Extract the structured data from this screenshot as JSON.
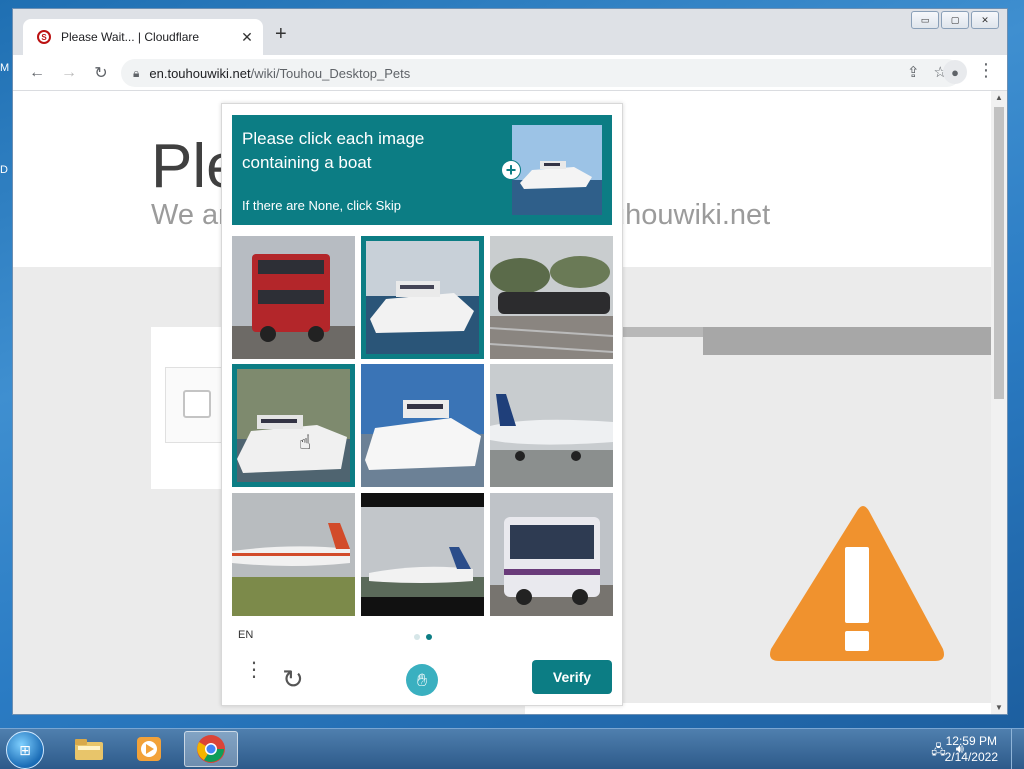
{
  "desktop": {
    "left_fragments": [
      "M",
      "D"
    ]
  },
  "window": {
    "tab": {
      "title": "Please Wait... | Cloudflare",
      "close": "✕"
    },
    "new_tab": "+",
    "controls": {
      "minimize": "▭",
      "maximize": "▢",
      "close": "✕"
    }
  },
  "toolbar": {
    "back": "←",
    "forward": "→",
    "reload": "↻",
    "url_host": "en.touhouwiki.net",
    "url_path": "/wiki/Touhou_Desktop_Pets",
    "share": "⇪",
    "bookmark": "☆",
    "profile": "●",
    "menu": "⋮"
  },
  "page": {
    "title_fragment": "Ple",
    "subtitle_fragment": "We ar",
    "site_fragment": "uhouwiki.net",
    "warning_exclamation": "!"
  },
  "captcha": {
    "prompt_line": "Please click each image containing a boat",
    "prompt_sub": "If there are None, click Skip",
    "example_image": "boat",
    "add": "+",
    "grid": [
      {
        "image": "bus",
        "selected": false
      },
      {
        "image": "boat",
        "selected": true
      },
      {
        "image": "train",
        "selected": false
      },
      {
        "image": "boat",
        "selected": true
      },
      {
        "image": "boat",
        "selected": false
      },
      {
        "image": "airplane",
        "selected": false
      },
      {
        "image": "airplane",
        "selected": false
      },
      {
        "image": "airplane",
        "selected": false
      },
      {
        "image": "bus",
        "selected": false
      }
    ],
    "language": "EN",
    "page_dots": 2,
    "active_dot": 1,
    "menu": "⋮",
    "refresh": "↻",
    "verify": "Verify"
  },
  "taskbar": {
    "start": "⊞",
    "apps": [
      "file-explorer",
      "media-player",
      "chrome"
    ],
    "tray_icons": [
      "network",
      "volume"
    ],
    "time": "12:59 PM",
    "date": "2/14/2022"
  },
  "colors": {
    "accent": "#0c7d84",
    "warning": "#f0922e"
  }
}
